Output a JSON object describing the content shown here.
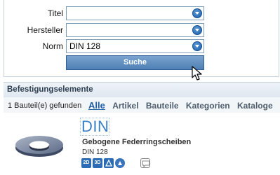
{
  "form": {
    "rows": [
      {
        "label": "Titel",
        "value": ""
      },
      {
        "label": "Hersteller",
        "value": ""
      },
      {
        "label": "Norm",
        "value": "DIN 128"
      }
    ],
    "search_button": "Suche"
  },
  "results": {
    "section_title": "Befestigungselemente",
    "found_text": "1 Bauteil(e) gefunden",
    "filters": [
      "Alle",
      "Artikel",
      "Bauteile",
      "Kategorien",
      "Kataloge"
    ],
    "active_filter": "Alle"
  },
  "item": {
    "title": "DIN",
    "description": "Gebogene Federringscheiben",
    "norm": "DIN 128",
    "icons": [
      "2d-icon",
      "3d-icon",
      "triangle-icon",
      "round-icon",
      "comment-icon"
    ],
    "icon_labels": {
      "2d": "2D",
      "3d": "3D"
    }
  },
  "colors": {
    "accent": "#1e5fa7",
    "button": "#4f7fb4",
    "header_bg": "#dfe7f0"
  }
}
